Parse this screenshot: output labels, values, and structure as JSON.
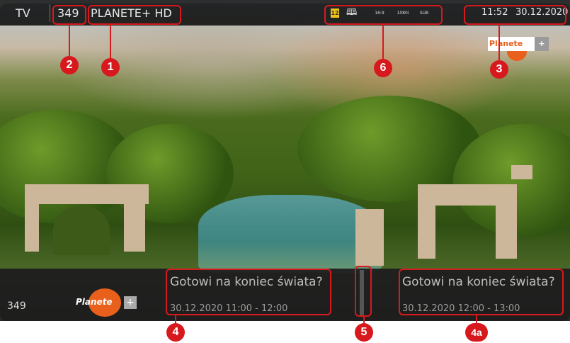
{
  "top_bar": {
    "tv_label": "TV",
    "channel_number": "349",
    "channel_name": "PLANETE+ HD",
    "time": "11:52",
    "date": "30.12.2020",
    "badges": {
      "age_rating": "12",
      "aspect": "16:9",
      "resolution": "1080i",
      "subtitles": "SUB"
    }
  },
  "watermark": {
    "logo_text": "Planete",
    "plus": "+"
  },
  "bottom_bar": {
    "channel_number": "349",
    "logo_text": "Planete",
    "logo_plus": "+",
    "current_program": {
      "title": "Gotowi na koniec świata?",
      "time": "30.12.2020 11:00 - 12:00"
    },
    "next_program": {
      "title": "Gotowi na koniec świata?",
      "time": "30.12.2020 12:00 - 13:00"
    }
  },
  "markers": {
    "m1": "1",
    "m2": "2",
    "m3": "3",
    "m4": "4",
    "m4a": "4a",
    "m5": "5",
    "m6": "6"
  },
  "colors": {
    "annotation": "#d7191e",
    "brand_orange": "#e8601c",
    "age_badge": "#f0c419"
  }
}
